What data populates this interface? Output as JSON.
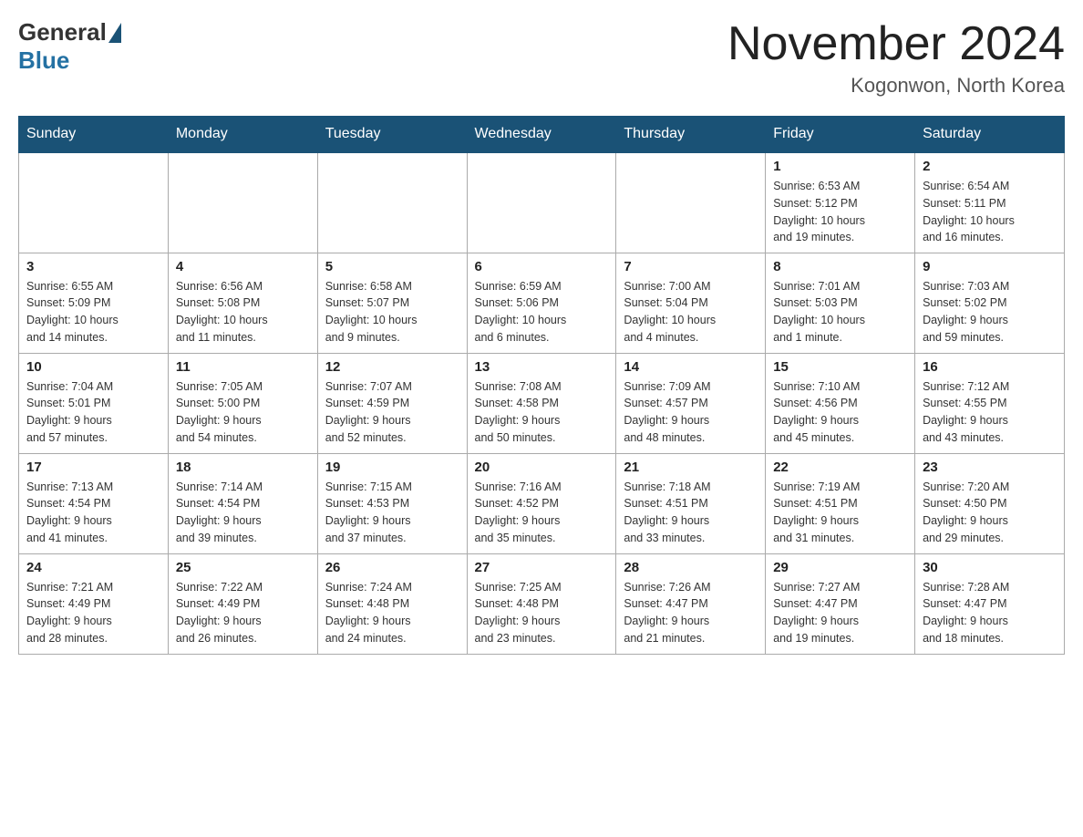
{
  "header": {
    "logo_general": "General",
    "logo_blue": "Blue",
    "month_year": "November 2024",
    "location": "Kogonwon, North Korea"
  },
  "weekdays": [
    "Sunday",
    "Monday",
    "Tuesday",
    "Wednesday",
    "Thursday",
    "Friday",
    "Saturday"
  ],
  "weeks": [
    [
      {
        "day": "",
        "info": ""
      },
      {
        "day": "",
        "info": ""
      },
      {
        "day": "",
        "info": ""
      },
      {
        "day": "",
        "info": ""
      },
      {
        "day": "",
        "info": ""
      },
      {
        "day": "1",
        "info": "Sunrise: 6:53 AM\nSunset: 5:12 PM\nDaylight: 10 hours\nand 19 minutes."
      },
      {
        "day": "2",
        "info": "Sunrise: 6:54 AM\nSunset: 5:11 PM\nDaylight: 10 hours\nand 16 minutes."
      }
    ],
    [
      {
        "day": "3",
        "info": "Sunrise: 6:55 AM\nSunset: 5:09 PM\nDaylight: 10 hours\nand 14 minutes."
      },
      {
        "day": "4",
        "info": "Sunrise: 6:56 AM\nSunset: 5:08 PM\nDaylight: 10 hours\nand 11 minutes."
      },
      {
        "day": "5",
        "info": "Sunrise: 6:58 AM\nSunset: 5:07 PM\nDaylight: 10 hours\nand 9 minutes."
      },
      {
        "day": "6",
        "info": "Sunrise: 6:59 AM\nSunset: 5:06 PM\nDaylight: 10 hours\nand 6 minutes."
      },
      {
        "day": "7",
        "info": "Sunrise: 7:00 AM\nSunset: 5:04 PM\nDaylight: 10 hours\nand 4 minutes."
      },
      {
        "day": "8",
        "info": "Sunrise: 7:01 AM\nSunset: 5:03 PM\nDaylight: 10 hours\nand 1 minute."
      },
      {
        "day": "9",
        "info": "Sunrise: 7:03 AM\nSunset: 5:02 PM\nDaylight: 9 hours\nand 59 minutes."
      }
    ],
    [
      {
        "day": "10",
        "info": "Sunrise: 7:04 AM\nSunset: 5:01 PM\nDaylight: 9 hours\nand 57 minutes."
      },
      {
        "day": "11",
        "info": "Sunrise: 7:05 AM\nSunset: 5:00 PM\nDaylight: 9 hours\nand 54 minutes."
      },
      {
        "day": "12",
        "info": "Sunrise: 7:07 AM\nSunset: 4:59 PM\nDaylight: 9 hours\nand 52 minutes."
      },
      {
        "day": "13",
        "info": "Sunrise: 7:08 AM\nSunset: 4:58 PM\nDaylight: 9 hours\nand 50 minutes."
      },
      {
        "day": "14",
        "info": "Sunrise: 7:09 AM\nSunset: 4:57 PM\nDaylight: 9 hours\nand 48 minutes."
      },
      {
        "day": "15",
        "info": "Sunrise: 7:10 AM\nSunset: 4:56 PM\nDaylight: 9 hours\nand 45 minutes."
      },
      {
        "day": "16",
        "info": "Sunrise: 7:12 AM\nSunset: 4:55 PM\nDaylight: 9 hours\nand 43 minutes."
      }
    ],
    [
      {
        "day": "17",
        "info": "Sunrise: 7:13 AM\nSunset: 4:54 PM\nDaylight: 9 hours\nand 41 minutes."
      },
      {
        "day": "18",
        "info": "Sunrise: 7:14 AM\nSunset: 4:54 PM\nDaylight: 9 hours\nand 39 minutes."
      },
      {
        "day": "19",
        "info": "Sunrise: 7:15 AM\nSunset: 4:53 PM\nDaylight: 9 hours\nand 37 minutes."
      },
      {
        "day": "20",
        "info": "Sunrise: 7:16 AM\nSunset: 4:52 PM\nDaylight: 9 hours\nand 35 minutes."
      },
      {
        "day": "21",
        "info": "Sunrise: 7:18 AM\nSunset: 4:51 PM\nDaylight: 9 hours\nand 33 minutes."
      },
      {
        "day": "22",
        "info": "Sunrise: 7:19 AM\nSunset: 4:51 PM\nDaylight: 9 hours\nand 31 minutes."
      },
      {
        "day": "23",
        "info": "Sunrise: 7:20 AM\nSunset: 4:50 PM\nDaylight: 9 hours\nand 29 minutes."
      }
    ],
    [
      {
        "day": "24",
        "info": "Sunrise: 7:21 AM\nSunset: 4:49 PM\nDaylight: 9 hours\nand 28 minutes."
      },
      {
        "day": "25",
        "info": "Sunrise: 7:22 AM\nSunset: 4:49 PM\nDaylight: 9 hours\nand 26 minutes."
      },
      {
        "day": "26",
        "info": "Sunrise: 7:24 AM\nSunset: 4:48 PM\nDaylight: 9 hours\nand 24 minutes."
      },
      {
        "day": "27",
        "info": "Sunrise: 7:25 AM\nSunset: 4:48 PM\nDaylight: 9 hours\nand 23 minutes."
      },
      {
        "day": "28",
        "info": "Sunrise: 7:26 AM\nSunset: 4:47 PM\nDaylight: 9 hours\nand 21 minutes."
      },
      {
        "day": "29",
        "info": "Sunrise: 7:27 AM\nSunset: 4:47 PM\nDaylight: 9 hours\nand 19 minutes."
      },
      {
        "day": "30",
        "info": "Sunrise: 7:28 AM\nSunset: 4:47 PM\nDaylight: 9 hours\nand 18 minutes."
      }
    ]
  ]
}
